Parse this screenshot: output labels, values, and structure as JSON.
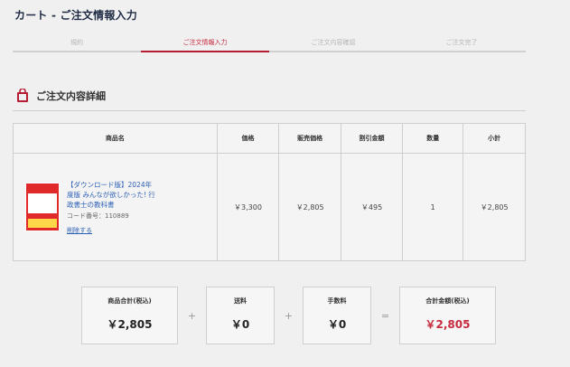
{
  "page": {
    "title": "カート - ご注文情報入力"
  },
  "steps": [
    {
      "label": "規約"
    },
    {
      "label": "ご注文情報入力"
    },
    {
      "label": "ご注文内容確認"
    },
    {
      "label": "ご注文完了"
    }
  ],
  "section": {
    "title": "ご注文内容詳細",
    "icon": "shopping-bag-icon"
  },
  "table": {
    "headers": [
      "商品名",
      "価格",
      "販売価格",
      "割引金額",
      "数量",
      "小計"
    ],
    "row": {
      "product_name": "【ダウンロード版】2024年度版 みんなが欲しかった! 行政書士の教科書",
      "code": "コード番号：110889",
      "remove_label": "削除する",
      "price": "￥3,300",
      "sale_price": "￥2,805",
      "discount": "￥495",
      "quantity": "1",
      "subtotal": "￥2,805"
    }
  },
  "summary": {
    "items_label": "商品合計(税込)",
    "items_value": "￥2,805",
    "shipping_label": "送料",
    "shipping_value": "￥0",
    "fee_label": "手数料",
    "fee_value": "￥0",
    "total_label": "合計金額(税込)",
    "total_value": "￥2,805",
    "plus": "+",
    "equals": "="
  },
  "colors": {
    "accent": "#b51d33",
    "link": "#2b5fb5"
  }
}
